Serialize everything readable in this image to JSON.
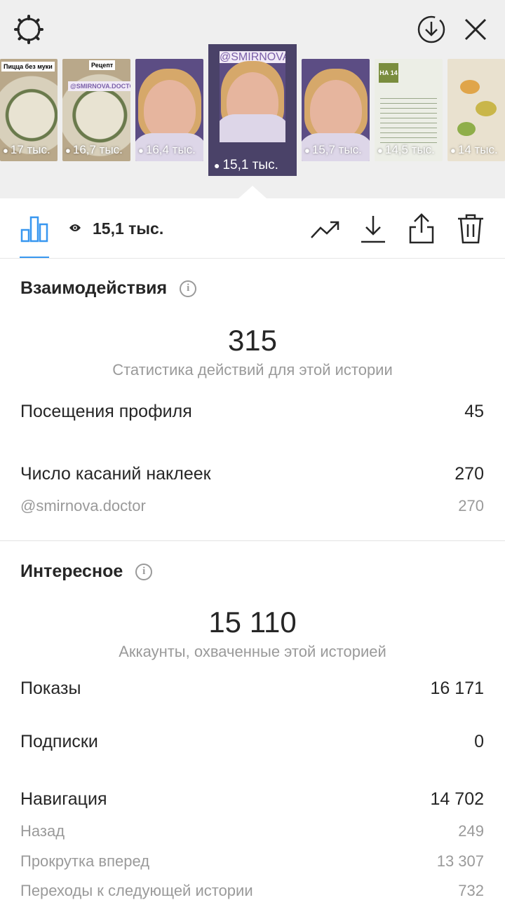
{
  "thumbnails": [
    {
      "views": "17 тыс.",
      "caption": "Пицца без муки"
    },
    {
      "views": "16,7 тыс.",
      "caption": "Рецепт",
      "tag": "@SMIRNOVA.DOCTOR"
    },
    {
      "views": "16,4 тыс."
    },
    {
      "views": "15,1 тыс.",
      "tag": "@SMIRNOVA.DOCTOR",
      "selected": true
    },
    {
      "views": "15,7 тыс."
    },
    {
      "views": "14,5 тыс.",
      "badge": "НА 14"
    },
    {
      "views": "14 тыс."
    }
  ],
  "toolbar": {
    "views_label": "15,1 тыс.",
    "icons": [
      "bar-chart-icon",
      "eye-icon",
      "trending-up-icon",
      "download-icon",
      "share-icon",
      "trash-icon"
    ]
  },
  "interactions": {
    "title": "Взаимодействия",
    "total": "315",
    "total_caption": "Статистика действий для этой истории",
    "rows": [
      {
        "label": "Посещения профиля",
        "value": "45"
      },
      {
        "label": "Число касаний наклеек",
        "value": "270"
      },
      {
        "label": "@smirnova.doctor",
        "value": "270",
        "minor": true
      }
    ]
  },
  "discovery": {
    "title": "Интересное",
    "total": "15 110",
    "total_caption": "Аккаунты, охваченные этой историей",
    "rows": [
      {
        "label": "Показы",
        "value": "16 171"
      },
      {
        "label": "Подписки",
        "value": "0"
      },
      {
        "label": "Навигация",
        "value": "14 702"
      },
      {
        "label": "Назад",
        "value": "249",
        "minor": true
      },
      {
        "label": "Прокрутка вперед",
        "value": "13 307",
        "minor": true
      },
      {
        "label": "Переходы к следующей истории",
        "value": "732",
        "minor": true
      }
    ]
  },
  "colors": {
    "accent": "#3897f0",
    "text": "#262626",
    "muted": "#9a9a9a",
    "header_bg": "#efefef"
  }
}
